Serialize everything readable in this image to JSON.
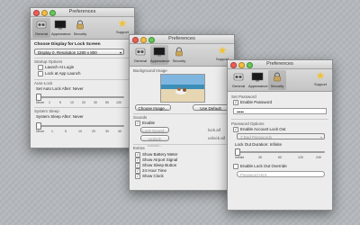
{
  "common": {
    "title": "Preferences",
    "tools": [
      "General",
      "Appearance",
      "Security"
    ],
    "support": "Support"
  },
  "win1": {
    "choose_display": "Choose Display for Lock Screen",
    "display_value": "Display 0, Resolution 1280 x 800",
    "startup_header": "Startup Options",
    "launch_at_login": "Launch At Login",
    "lock_at_launch": "Lock at App Launch",
    "autolock_header": "Auto-Lock",
    "set_autolock": "Set Auto Lock After: Never",
    "autolock_ticks": [
      "1",
      "5",
      "10",
      "20",
      "30",
      "50",
      "100"
    ],
    "never": "Never",
    "autolock_level": 0,
    "sleep_header": "System Sleep",
    "sleep_after": "System Sleep After: Never",
    "sleep_ticks": [
      "1",
      "5",
      "10",
      "20",
      "30",
      "40"
    ],
    "sleep_level": 0
  },
  "win2": {
    "bg_header": "Background Image",
    "choose_image": "Choose Image...",
    "use_default": "Use Default",
    "sounds_header": "Sounds",
    "enable": "Enable",
    "lock_sound": "Lock Sound...",
    "unlock_sound": "Unlock Sound...",
    "lock_sound_file": "lock.aif",
    "unlock_sound_file": "unlock.aif",
    "extras_header": "Extras",
    "show_battery": "Show Battery Meter",
    "show_airport": "Show Airport Signal",
    "show_sleep": "Show Sleep Button",
    "hour24": "24 Hour Time",
    "show_clock": "Show Clock"
  },
  "win3": {
    "set_password_header": "Set Password",
    "enable_password": "Enable Password",
    "password_value": "•••••",
    "password_options_header": "Password Options",
    "enable_lockout": "Enable Account Lock Out",
    "bad_passwords": "3 Bad Passwords",
    "lockout_duration": "Lock Out Duration: Infinite",
    "lockout_ticks": [
      "Infinite",
      "30",
      "60",
      "120",
      "240"
    ],
    "lockout_level": 0,
    "enable_override": "Enable Lock Out Override",
    "password_hint": "Password Hint"
  }
}
